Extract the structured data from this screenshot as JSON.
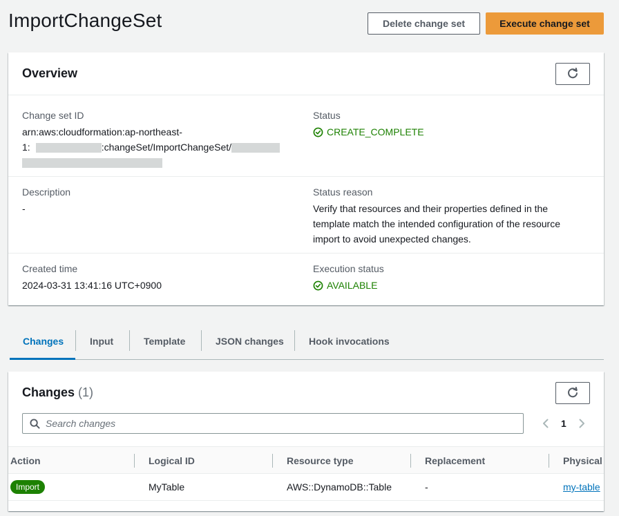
{
  "page": {
    "title": "ImportChangeSet",
    "delete_button": "Delete change set",
    "execute_button": "Execute change set"
  },
  "overview": {
    "title": "Overview",
    "change_set_id_label": "Change set ID",
    "change_set_id_line1": "arn:aws:cloudformation:ap-northeast-",
    "change_set_id_line2_prefix": "1:",
    "change_set_id_line2_mid": ":changeSet/ImportChangeSet/",
    "status_label": "Status",
    "status_value": "CREATE_COMPLETE",
    "description_label": "Description",
    "description_value": "-",
    "status_reason_label": "Status reason",
    "status_reason_value": "Verify that resources and their properties defined in the template match the intended configuration of the resource import to avoid unexpected changes.",
    "created_time_label": "Created time",
    "created_time_value": "2024-03-31 13:41:16 UTC+0900",
    "execution_status_label": "Execution status",
    "execution_status_value": "AVAILABLE"
  },
  "tabs": [
    "Changes",
    "Input",
    "Template",
    "JSON changes",
    "Hook invocations"
  ],
  "changes": {
    "title": "Changes",
    "count": "(1)",
    "search_placeholder": "Search changes",
    "page_number": "1",
    "columns": [
      "Action",
      "Logical ID",
      "Resource type",
      "Replacement",
      "Physical I"
    ],
    "rows": [
      {
        "action": "Import",
        "logical_id": "MyTable",
        "resource_type": "AWS::DynamoDB::Table",
        "replacement": "-",
        "physical_id": "my-table"
      }
    ]
  },
  "colors": {
    "primary_button": "#ec9a3a",
    "success_green": "#1d8102",
    "link_blue": "#0073bb"
  }
}
